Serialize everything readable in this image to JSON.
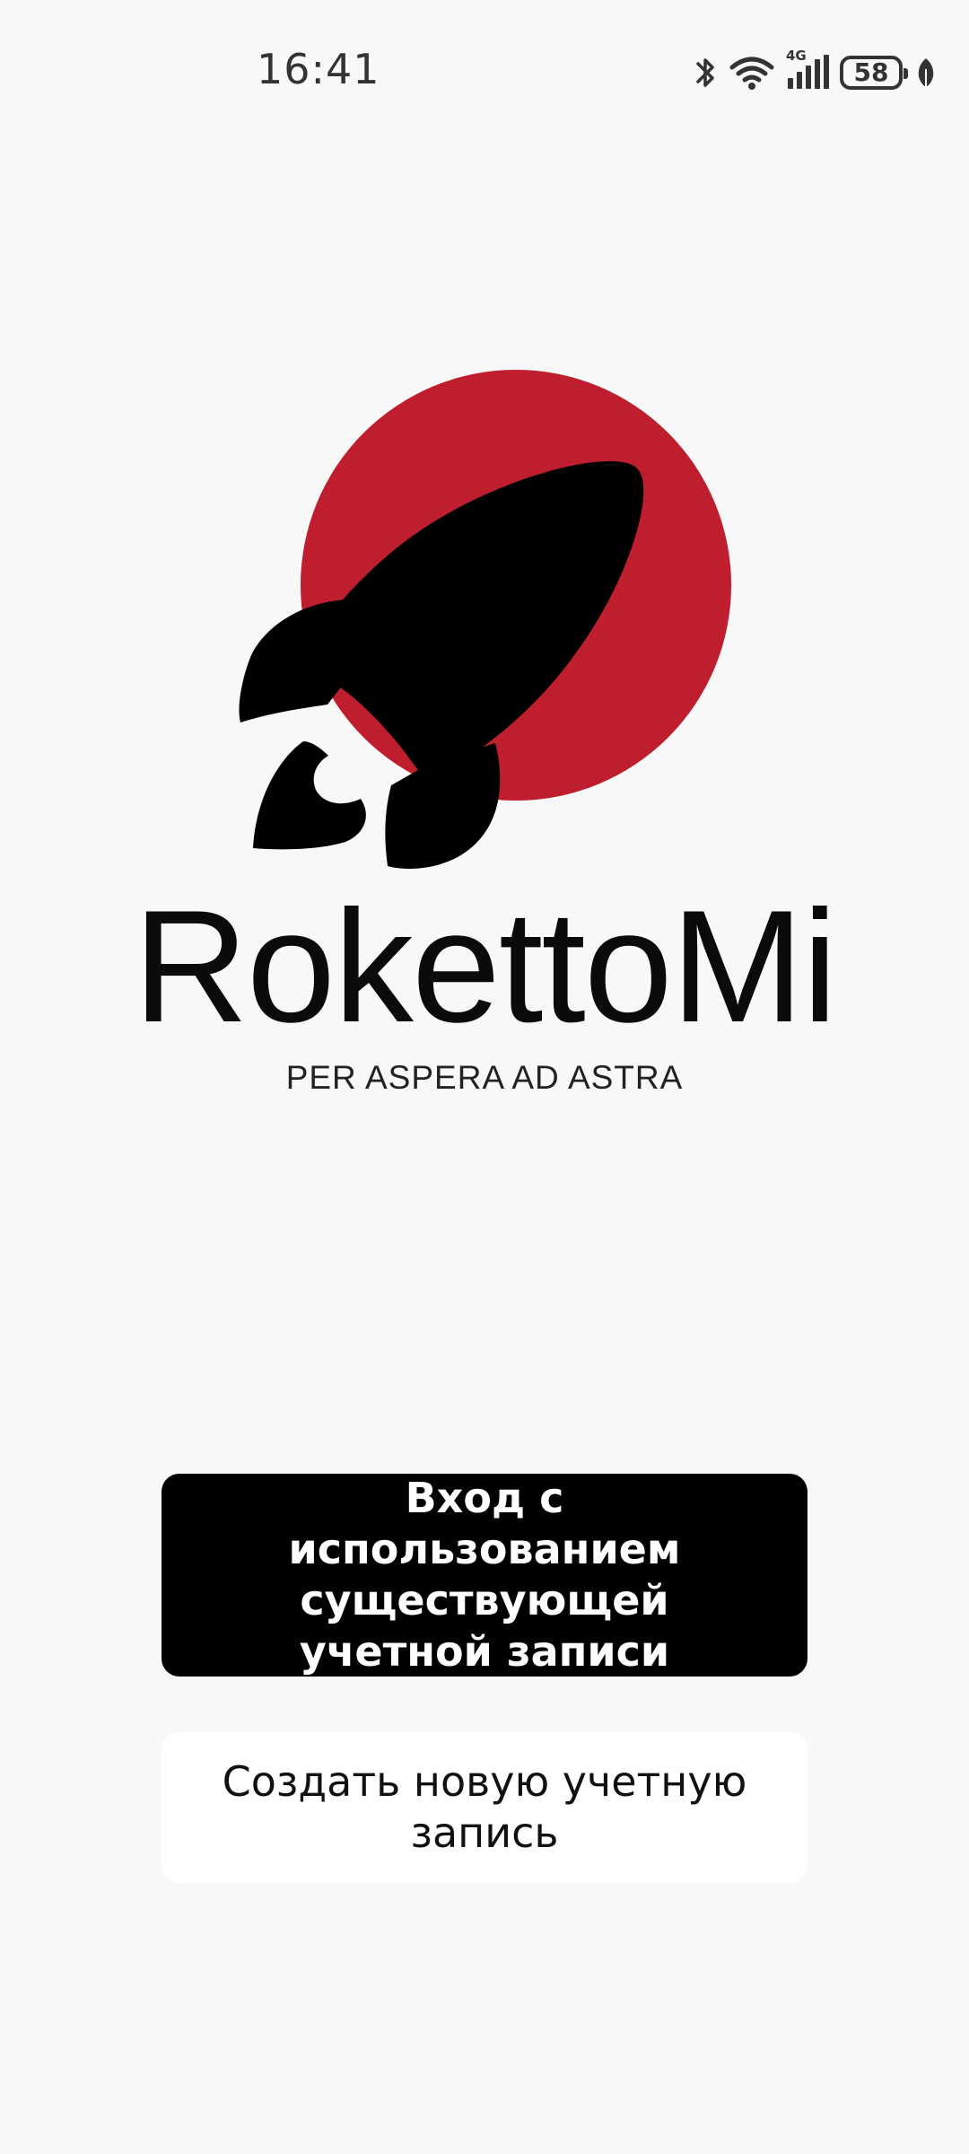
{
  "status_bar": {
    "time": "16:41",
    "network_type": "4G",
    "battery_level": "58",
    "icons": [
      "bluetooth-icon",
      "wifi-icon",
      "cellular-signal-icon",
      "battery-icon",
      "battery-saver-leaf-icon"
    ]
  },
  "brand": {
    "name": "RokettoMi",
    "tagline": "PER ASPERA AD ASTRA",
    "logo_icon": "rocket-icon",
    "colors": {
      "accent_red": "#be1e2d",
      "rocket": "#000000"
    }
  },
  "actions": {
    "login_label": "Вход с использованием существующей учетной записи",
    "register_label": "Создать новую учетную запись"
  }
}
